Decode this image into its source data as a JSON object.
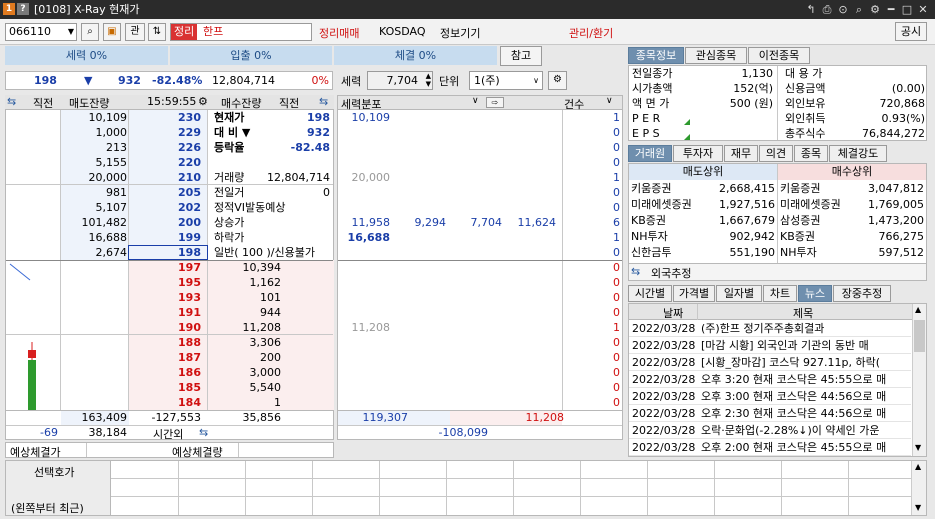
{
  "window": {
    "title": "[0108] X-Ray 현재가",
    "controls": [
      "↰",
      "⎙",
      "⊙",
      "⌕",
      "⚙",
      "━",
      "□",
      "✕"
    ]
  },
  "toolbar": {
    "code": "066110",
    "btn_gwan": "관",
    "tag_jeongni": "정리",
    "name": "한프",
    "status_text": "정리매매",
    "market": "KOSDAQ",
    "sector": "정보기기",
    "manage": "관리/환기",
    "notice": "공시"
  },
  "summary": {
    "seryeok": "세력 0%",
    "ipchul": "입출 0%",
    "chegyeol": "체결 0%",
    "ref_btn": "참고"
  },
  "quote": {
    "price": "198",
    "arrow": "▼",
    "change": "932",
    "rate": "-82.48%",
    "volume": "12,804,714",
    "pct": "0%"
  },
  "distribution": {
    "label_seryeok": "세력",
    "value": "7,704",
    "label_unit": "단위",
    "unit": "1(주)",
    "header": "세력분포",
    "count_header": "건수"
  },
  "orderbook": {
    "headers": {
      "left_dir": "직전",
      "sell": "매도잔량",
      "time": "15:59:55",
      "buy": "매수잔량",
      "right_dir": "직전"
    },
    "sell_rows": [
      {
        "sell": "10,109",
        "price": "230",
        "info_label": "현재가",
        "info_value": "198",
        "dist_a": "10,109",
        "dist_b": "",
        "dist_c": "",
        "dist_d": "",
        "count": "1"
      },
      {
        "sell": "1,000",
        "price": "229",
        "info_label": "대  비  ▼",
        "info_value": "932",
        "dist_a": "",
        "dist_b": "",
        "dist_c": "",
        "dist_d": "",
        "count": "0"
      },
      {
        "sell": "213",
        "price": "226",
        "info_label": "등락율",
        "info_value": "-82.48",
        "dist_a": "",
        "dist_b": "",
        "dist_c": "",
        "dist_d": "",
        "count": "0"
      },
      {
        "sell": "5,155",
        "price": "220",
        "info_label": "",
        "info_value": "",
        "dist_a": "",
        "dist_b": "",
        "dist_c": "",
        "dist_d": "",
        "count": "0"
      },
      {
        "sell": "20,000",
        "price": "210",
        "info_label": "거래량",
        "info_value": "12,804,714",
        "dist_a": "20,000",
        "dist_b": "",
        "dist_c": "",
        "dist_d": "",
        "count": "1"
      },
      {
        "sell": "981",
        "price": "205",
        "info_label": "전일거",
        "info_value": "0",
        "dist_a": "",
        "dist_b": "",
        "dist_c": "",
        "dist_d": "",
        "count": "0"
      },
      {
        "sell": "5,107",
        "price": "202",
        "info_label": "정적VI발동예상",
        "info_value": "",
        "dist_a": "",
        "dist_b": "",
        "dist_c": "",
        "dist_d": "",
        "count": "0"
      },
      {
        "sell": "101,482",
        "price": "200",
        "info_label": "상승가",
        "info_value": "",
        "dist_a": "11,958",
        "dist_b": "9,294",
        "dist_c": "7,704",
        "dist_d": "11,624",
        "count": "6"
      },
      {
        "sell": "16,688",
        "price": "199",
        "info_label": "하락가",
        "info_value": "",
        "dist_a": "16,688",
        "dist_b": "",
        "dist_c": "",
        "dist_d": "",
        "count": "1"
      },
      {
        "sell": "2,674",
        "price": "198",
        "info_label": "일반( 100 )/신용불가",
        "info_value": "",
        "dist_a": "",
        "dist_b": "",
        "dist_c": "",
        "dist_d": "",
        "count": "0"
      }
    ],
    "buy_rows": [
      {
        "price": "197",
        "buy": "10,394",
        "dist": "",
        "count": "0"
      },
      {
        "price": "195",
        "buy": "1,162",
        "dist": "",
        "count": "0"
      },
      {
        "price": "193",
        "buy": "101",
        "dist": "",
        "count": "0"
      },
      {
        "price": "191",
        "buy": "944",
        "dist": "",
        "count": "0"
      },
      {
        "price": "190",
        "buy": "11,208",
        "dist": "11,208",
        "count": "1"
      },
      {
        "price": "188",
        "buy": "3,306",
        "dist": "",
        "count": "0"
      },
      {
        "price": "187",
        "buy": "200",
        "dist": "",
        "count": "0"
      },
      {
        "price": "186",
        "buy": "3,000",
        "dist": "",
        "count": "0"
      },
      {
        "price": "185",
        "buy": "5,540",
        "dist": "",
        "count": "0"
      },
      {
        "price": "184",
        "buy": "1",
        "dist": "",
        "count": "0"
      }
    ],
    "totals": {
      "sell_total": "163,409",
      "diff": "-127,553",
      "buy_total": "35,856",
      "dist_sell": "119,307",
      "dist_buy": "11,208",
      "prev": "-69",
      "after_hours": "38,184",
      "after_label": "시간외",
      "dist_diff": "-108,099"
    },
    "expected": {
      "price_label": "예상체결가",
      "volume_label": "예상체결량"
    }
  },
  "stockinfo": {
    "tabs": [
      "종목정보",
      "관심종목",
      "이전종목"
    ],
    "rows": [
      {
        "l1": "전일종가",
        "v1": "1,130",
        "l2": "대 용 가",
        "v2": ""
      },
      {
        "l1": "시가총액",
        "v1": "152(억)",
        "l2": "신용금액",
        "v2": "(0.00)"
      },
      {
        "l1": "액 면 가",
        "v1": "500 (원)",
        "l2": "외인보유",
        "v2": "720,868"
      },
      {
        "l1": "P E R",
        "v1": "",
        "l2": "외인취득",
        "v2": "0.93(%)"
      },
      {
        "l1": "E P S",
        "v1": "",
        "l2": "총주식수",
        "v2": "76,844,272"
      }
    ]
  },
  "broker": {
    "tabs": [
      "거래원",
      "투자자",
      "재무",
      "의견",
      "종목",
      "체결강도"
    ],
    "sell_header": "매도상위",
    "buy_header": "매수상위",
    "rows": [
      {
        "sn": "키움증권",
        "sv": "2,668,415",
        "bn": "키움증권",
        "bv": "3,047,812"
      },
      {
        "sn": "미래에셋증권",
        "sv": "1,927,516",
        "bn": "미래에셋증권",
        "bv": "1,769,005"
      },
      {
        "sn": "KB증권",
        "sv": "1,667,679",
        "bn": "삼성증권",
        "bv": "1,473,200"
      },
      {
        "sn": "NH투자",
        "sv": "902,942",
        "bn": "KB증권",
        "bv": "766,275"
      },
      {
        "sn": "신한금투",
        "sv": "551,190",
        "bn": "NH투자",
        "bv": "597,512"
      }
    ],
    "foreign": "외국추정"
  },
  "news": {
    "tabs": [
      "시간별",
      "가격별",
      "일자별",
      "차트",
      "뉴스",
      "장중추정"
    ],
    "date_header": "날짜",
    "title_header": "제목",
    "items": [
      {
        "date": "2022/03/28",
        "title": "(주)한프 정기주주총회결과"
      },
      {
        "date": "2022/03/28",
        "title": "[마감 시황] 외국인과 기관의 동반 매"
      },
      {
        "date": "2022/03/28",
        "title": "[시황_장마감] 코스닥 927.11p, 하락("
      },
      {
        "date": "2022/03/28",
        "title": "오후 3:20 현재 코스닥은 45:55으로 매"
      },
      {
        "date": "2022/03/28",
        "title": "오후 3:00 현재 코스닥은 44:56으로 매"
      },
      {
        "date": "2022/03/28",
        "title": "오후 2:30 현재 코스닥은 44:56으로 매"
      },
      {
        "date": "2022/03/28",
        "title": "오락·문화업(-2.28%↓)이 약세인 가운"
      },
      {
        "date": "2022/03/28",
        "title": "오후 2:00 현재 코스닥은 45:55으로 매"
      }
    ]
  },
  "bottom": {
    "label1": "선택호가",
    "label2": "(왼쪽부터 최근)"
  }
}
